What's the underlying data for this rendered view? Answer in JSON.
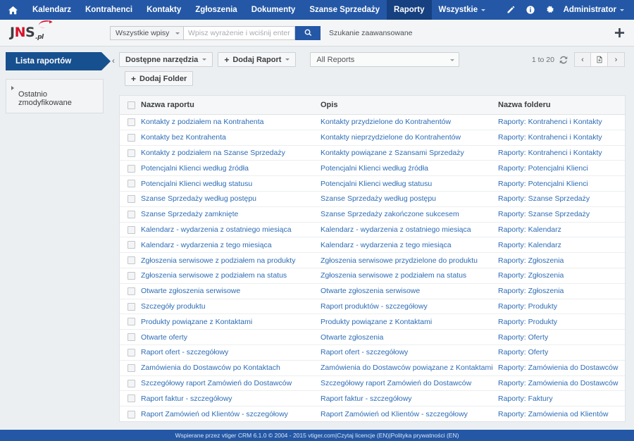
{
  "topnav": {
    "home_icon": "home-icon",
    "items": [
      {
        "label": "Kalendarz",
        "active": false,
        "caret": false
      },
      {
        "label": "Kontrahenci",
        "active": false,
        "caret": false
      },
      {
        "label": "Kontakty",
        "active": false,
        "caret": false
      },
      {
        "label": "Zgłoszenia",
        "active": false,
        "caret": false
      },
      {
        "label": "Dokumenty",
        "active": false,
        "caret": false
      },
      {
        "label": "Szanse Sprzedaży",
        "active": false,
        "caret": false
      },
      {
        "label": "Raporty",
        "active": true,
        "caret": false
      },
      {
        "label": "Wszystkie",
        "active": false,
        "caret": true
      }
    ],
    "right_icons": [
      "pencil-icon",
      "info-icon",
      "gear-icon"
    ],
    "user_label": "Administrator"
  },
  "brand": {
    "name_j": "J",
    "name_n": "N",
    "name_s": "S",
    "suffix": ".pl",
    "swoosh_color": "#d6122a"
  },
  "search": {
    "scope_value": "Wszystkie wpisy",
    "placeholder": "Wpisz wyrażenie i wciśnij enter",
    "input_value": "",
    "search_icon": "search-icon",
    "advanced_label": "Szukanie zaawansowane",
    "add_icon": "plus-icon"
  },
  "sidebar": {
    "active_item": "Lista raportów",
    "box_item": "Ostatnio zmodyfikowane",
    "collapse_icon": "chevron-left-icon"
  },
  "toolbar": {
    "tools_label": "Dostępne narzędzia",
    "add_report_label": "Dodaj Raport",
    "add_folder_label": "Dodaj Folder",
    "plus_glyph": "+",
    "filter_value": "All Reports"
  },
  "pager": {
    "count_label": "1 to 20",
    "refresh_icon": "refresh-icon",
    "prev_icon": "chevron-left-icon",
    "export_icon": "export-page-icon",
    "next_icon": "chevron-right-icon"
  },
  "table": {
    "headers": [
      "Nazwa raportu",
      "Opis",
      "Nazwa folderu"
    ],
    "rows": [
      {
        "name": "Kontakty z podziałem na Kontrahenta",
        "desc": "Kontakty przydzielone do Kontrahentów",
        "folder": "Raporty: Kontrahenci i Kontakty"
      },
      {
        "name": "Kontakty bez Kontrahenta",
        "desc": "Kontakty nieprzydzielone do Kontrahentów",
        "folder": "Raporty: Kontrahenci i Kontakty"
      },
      {
        "name": "Kontakty z podziałem na Szanse Sprzedaży",
        "desc": "Kontakty powiązane z Szansami Sprzedaży",
        "folder": "Raporty: Kontrahenci i Kontakty"
      },
      {
        "name": "Potencjalni Klienci według źródła",
        "desc": "Potencjalni Klienci według źródła",
        "folder": "Raporty: Potencjalni Klienci"
      },
      {
        "name": "Potencjalni Klienci według statusu",
        "desc": "Potencjalni Klienci według statusu",
        "folder": "Raporty: Potencjalni Klienci"
      },
      {
        "name": "Szanse Sprzedaży według postępu",
        "desc": "Szanse Sprzedaży według postępu",
        "folder": "Raporty: Szanse Sprzedaży"
      },
      {
        "name": "Szanse Sprzedaży zamknięte",
        "desc": "Szanse Sprzedaży zakończone sukcesem",
        "folder": "Raporty: Szanse Sprzedaży"
      },
      {
        "name": "Kalendarz - wydarzenia z ostatniego miesiąca",
        "desc": "Kalendarz - wydarzenia z ostatniego miesiąca",
        "folder": "Raporty: Kalendarz"
      },
      {
        "name": "Kalendarz - wydarzenia z tego miesiąca",
        "desc": "Kalendarz - wydarzenia z tego miesiąca",
        "folder": "Raporty: Kalendarz"
      },
      {
        "name": "Zgłoszenia serwisowe z podziałem na produkty",
        "desc": "Zgłoszenia serwisowe przydzielone do produktu",
        "folder": "Raporty: Zgłoszenia"
      },
      {
        "name": "Zgłoszenia serwisowe z podziałem na status",
        "desc": "Zgłoszenia serwisowe z podziałem na status",
        "folder": "Raporty: Zgłoszenia"
      },
      {
        "name": "Otwarte zgłoszenia serwisowe",
        "desc": "Otwarte zgłoszenia serwisowe",
        "folder": "Raporty: Zgłoszenia"
      },
      {
        "name": "Szczegóły produktu",
        "desc": "Raport produktów - szczegółowy",
        "folder": "Raporty: Produkty"
      },
      {
        "name": "Produkty powiązane z Kontaktami",
        "desc": "Produkty powiązane z Kontaktami",
        "folder": "Raporty: Produkty"
      },
      {
        "name": "Otwarte oferty",
        "desc": "Otwarte zgłoszenia",
        "folder": "Raporty: Oferty"
      },
      {
        "name": "Raport ofert - szczegółowy",
        "desc": "Raport ofert - szczegółowy",
        "folder": "Raporty: Oferty"
      },
      {
        "name": "Zamówienia do Dostawców po Kontaktach",
        "desc": "Zamówienia do Dostawców powiązane z Kontaktami",
        "folder": "Raporty: Zamówienia do Dostawców"
      },
      {
        "name": "Szczegółowy raport Zamówień do Dostawców",
        "desc": "Szczegółowy raport Zamówień do Dostawców",
        "folder": "Raporty: Zamówienia do Dostawców"
      },
      {
        "name": "Raport faktur - szczegółowy",
        "desc": "Raport faktur - szczegółowy",
        "folder": "Raporty: Faktury"
      },
      {
        "name": "Raport Zamówień od Klientów - szczegółowy",
        "desc": "Raport Zamówień od Klientów - szczegółowy",
        "folder": "Raporty: Zamówienia od Klientów"
      }
    ]
  },
  "footer": {
    "powered": "Wspierane przez vtiger CRM 6.1.0",
    "copyright": "© 2004 - 2015",
    "site": "vtiger.com",
    "sep1": " | ",
    "license": "Czytaj licencje (EN)",
    "sep2": " | ",
    "privacy": "Polityka prywatności (EN)"
  },
  "colors": {
    "nav_blue": "#2458a6",
    "nav_active": "#16407f",
    "link_blue": "#2d6cb5",
    "brand_red": "#d6122a",
    "page_bg": "#eceff1"
  }
}
